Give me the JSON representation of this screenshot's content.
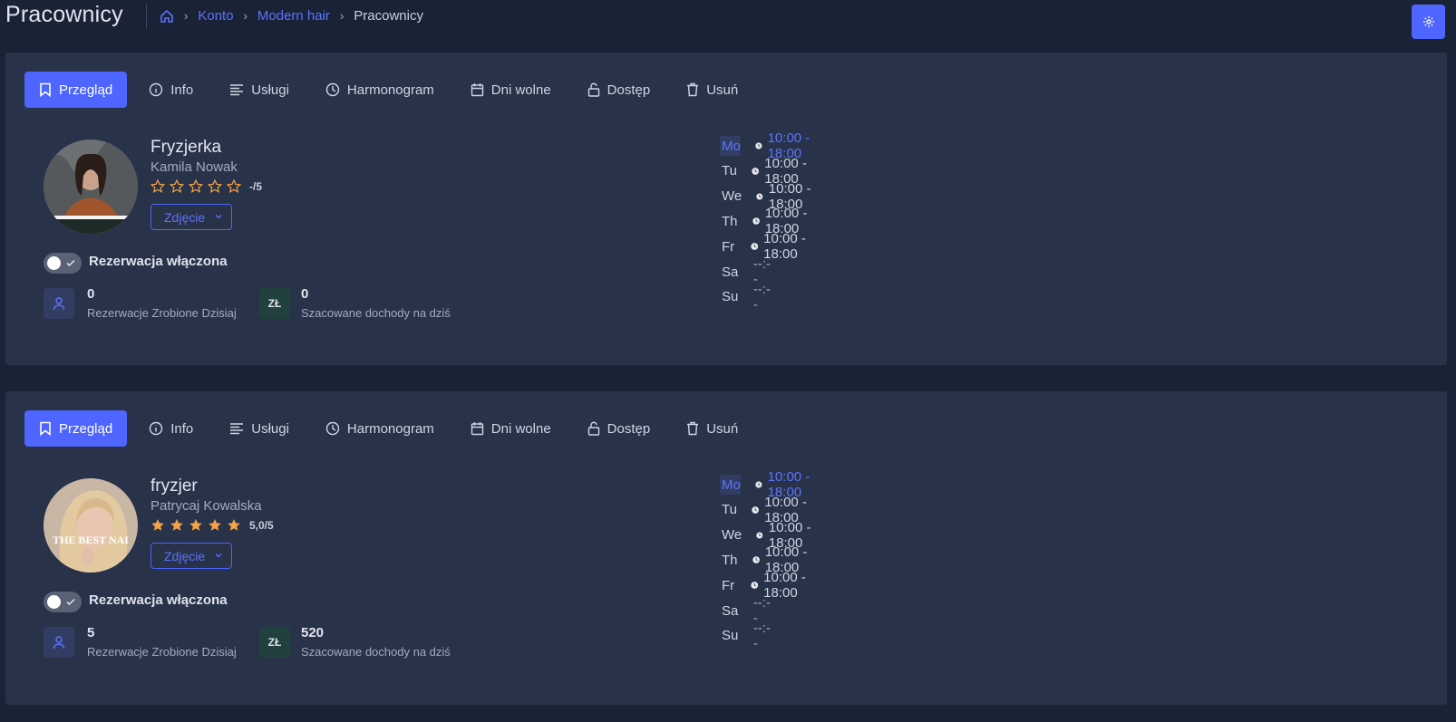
{
  "page": {
    "title": "Pracownicy",
    "breadcrumb": [
      "Konto",
      "Modern hair",
      "Pracownicy"
    ]
  },
  "tabs": [
    {
      "label": "Przegląd",
      "icon": "bookmark-icon",
      "active": true
    },
    {
      "label": "Info",
      "icon": "info-icon"
    },
    {
      "label": "Usługi",
      "icon": "list-icon"
    },
    {
      "label": "Harmonogram",
      "icon": "clock-icon"
    },
    {
      "label": "Dni wolne",
      "icon": "calendar-icon"
    },
    {
      "label": "Dostęp",
      "icon": "unlock-icon"
    },
    {
      "label": "Usuń",
      "icon": "trash-icon"
    }
  ],
  "employees": [
    {
      "role": "Fryzjerka",
      "name": "Kamila Nowak",
      "rating": "-/5",
      "rating_value": 0,
      "photo_button": "Zdjęcie",
      "toggle_label": "Rezerwacja włączona",
      "reservations_value": "0",
      "reservations_label": "Rezerwacje Zrobione Dzisiaj",
      "currency_badge": "ZŁ",
      "income_value": "0",
      "income_label": "Szacowane dochody na dziś",
      "schedule": [
        {
          "day": "Mo",
          "hours": "10:00 - 18:00",
          "active": true
        },
        {
          "day": "Tu",
          "hours": "10:00 - 18:00"
        },
        {
          "day": "We",
          "hours": "10:00 - 18:00"
        },
        {
          "day": "Th",
          "hours": "10:00 - 18:00"
        },
        {
          "day": "Fr",
          "hours": "10:00 - 18:00"
        },
        {
          "day": "Sa",
          "hours": "--:--",
          "off": true
        },
        {
          "day": "Su",
          "hours": "--:--",
          "off": true
        }
      ]
    },
    {
      "role": "fryzjer",
      "name": "Patrycaj Kowalska",
      "rating": "5,0/5",
      "rating_value": 5,
      "photo_button": "Zdjęcie",
      "photo_text": "THE BEST NAI",
      "toggle_label": "Rezerwacja włączona",
      "reservations_value": "5",
      "reservations_label": "Rezerwacje Zrobione Dzisiaj",
      "currency_badge": "ZŁ",
      "income_value": "520",
      "income_label": "Szacowane dochody na dziś",
      "schedule": [
        {
          "day": "Mo",
          "hours": "10:00 - 18:00",
          "active": true
        },
        {
          "day": "Tu",
          "hours": "10:00 - 18:00"
        },
        {
          "day": "We",
          "hours": "10:00 - 18:00"
        },
        {
          "day": "Th",
          "hours": "10:00 - 18:00"
        },
        {
          "day": "Fr",
          "hours": "10:00 - 18:00"
        },
        {
          "day": "Sa",
          "hours": "--:--",
          "off": true
        },
        {
          "day": "Su",
          "hours": "--:--",
          "off": true
        }
      ]
    }
  ],
  "colors": {
    "accent": "#4e65ff",
    "link": "#5b73ff",
    "star": "#f5a347",
    "background": "#1a2236",
    "card": "#283248"
  }
}
